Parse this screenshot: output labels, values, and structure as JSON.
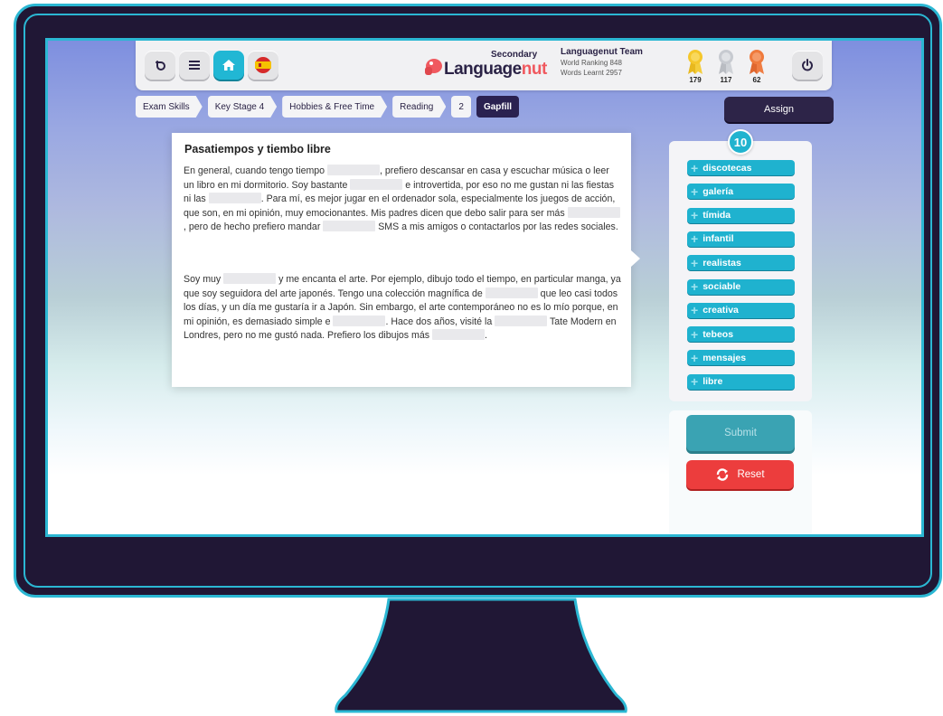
{
  "colors": {
    "accent": "#1fb2cf",
    "frame": "#201735",
    "frame_border": "#2bb7d3",
    "reset": "#ec3d3d",
    "dark_button": "#2d2448"
  },
  "toolbar": {
    "icons": [
      "back-icon",
      "menu-icon",
      "home-icon",
      "spain-flag-icon",
      "power-icon"
    ]
  },
  "logo": {
    "secondary": "Secondary",
    "name_part1": "Language",
    "name_part2": "nut"
  },
  "user": {
    "team": "Languagenut Team",
    "ranking": "World Ranking 848",
    "words": "Words Learnt 2957"
  },
  "medals": [
    {
      "color": "gold",
      "count": "179"
    },
    {
      "color": "silver",
      "count": "117"
    },
    {
      "color": "bronze",
      "count": "62"
    }
  ],
  "breadcrumb": [
    "Exam Skills",
    "Key Stage 4",
    "Hobbies & Free Time",
    "Reading",
    "2",
    "Gapfill"
  ],
  "assign_label": "Assign",
  "exercise": {
    "title": "Pasatiempos y tiembo libre",
    "p1": [
      "En general, cuando tengo tiempo ",
      "GAP",
      ", prefiero descansar en casa y escuchar música o leer un libro en mi dormitorio. Soy bastante ",
      "GAP",
      " e introvertida, por eso no me gustan ni las fiestas ni las ",
      "GAP",
      ". Para mí, es mejor jugar en el ordenador sola, especialmente los juegos de acción, que son, en mi opinión, muy emocionantes. Mis padres dicen que debo salir para ser más ",
      "GAP",
      ", pero de hecho prefiero mandar ",
      "GAP",
      " SMS a mis amigos o contactarlos por las redes sociales."
    ],
    "p2": [
      "Soy muy ",
      "GAP",
      " y me encanta el arte. Por ejemplo, dibujo todo el tiempo, en particular manga, ya que soy seguidora del arte japonés. Tengo una colección magnífica de ",
      "GAP",
      " que leo casi todos los días, y un día me gustaría ir a Japón. Sin embargo, el arte contemporáneo no es lo mío porque, en mi opinión, es demasiado simple e ",
      "GAP",
      ". Hace dos años, visité la ",
      "GAP",
      " Tate Modern en Londres, pero no me gustó nada. Prefiero los dibujos más ",
      "GAP",
      "."
    ]
  },
  "word_count": "10",
  "words": [
    "discotecas",
    "galería",
    "tímida",
    "infantil",
    "realistas",
    "sociable",
    "creativa",
    "tebeos",
    "mensajes",
    "libre"
  ],
  "submit_label": "Submit",
  "reset_label": "Reset"
}
